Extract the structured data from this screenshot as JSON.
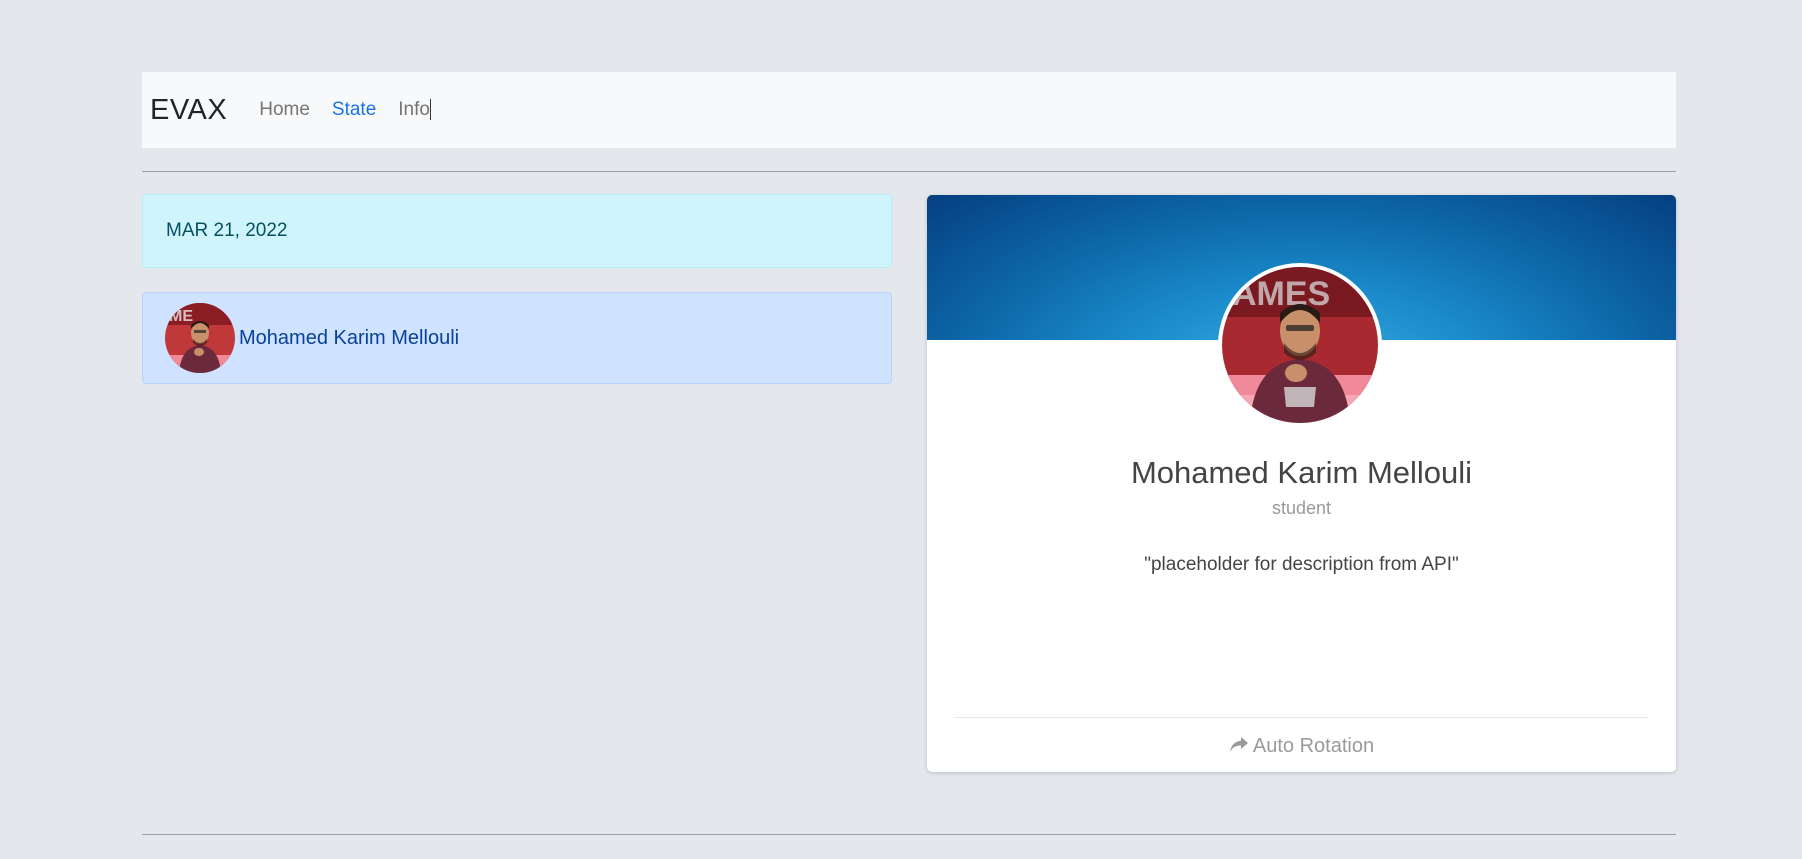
{
  "navbar": {
    "brand": "EVAX",
    "links": [
      {
        "label": "Home"
      },
      {
        "label": "State"
      },
      {
        "label": "Info"
      }
    ]
  },
  "date_banner": {
    "text": "MAR 21, 2022"
  },
  "user_list": {
    "items": [
      {
        "name": "Mohamed Karim Mellouli"
      }
    ]
  },
  "profile_card": {
    "name": "Mohamed Karim Mellouli",
    "role": "student",
    "description": "\"placeholder for description from API\"",
    "footer_label": "Auto Rotation",
    "footer_icon": "share-arrow-icon"
  },
  "colors": {
    "background": "#e4e8ed",
    "navbar_bg": "#f8f9fa",
    "active_link": "#1a73e8",
    "date_box_bg": "#cff4fc",
    "user_box_bg": "#cfe2ff",
    "banner_blue": "#0d67a8"
  }
}
